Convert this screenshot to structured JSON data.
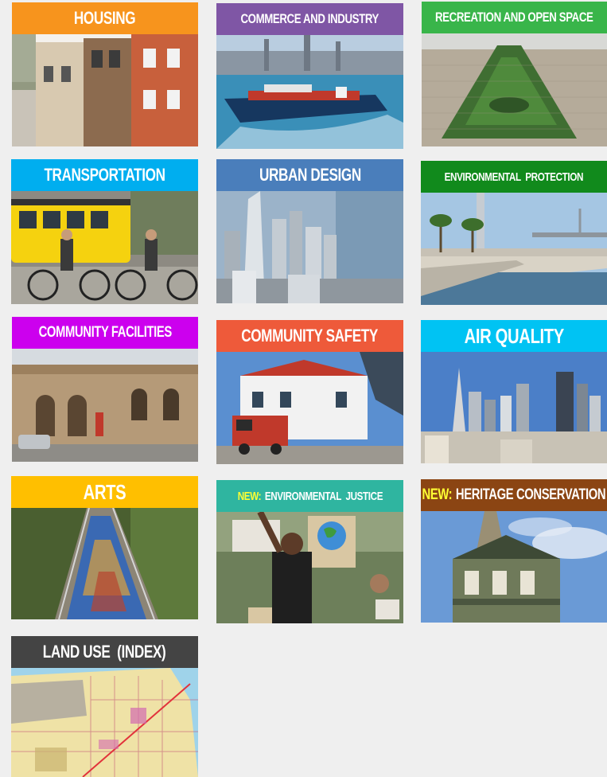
{
  "tiles": [
    {
      "id": "housing",
      "prefix": "",
      "label": "HOUSING",
      "color": "#f7941d"
    },
    {
      "id": "commerce",
      "prefix": "",
      "label": "COMMERCE AND INDUSTRY",
      "color": "#7f56a5"
    },
    {
      "id": "recreation",
      "prefix": "",
      "label": "RECREATION AND OPEN SPACE",
      "color": "#39b54a"
    },
    {
      "id": "transportation",
      "prefix": "",
      "label": "TRANSPORTATION",
      "color": "#00aeef"
    },
    {
      "id": "urban-design",
      "prefix": "",
      "label": "URBAN DESIGN",
      "color": "#4a7ebb"
    },
    {
      "id": "environmental-protection",
      "prefix": "",
      "label": "ENVIRONMENTAL  PROTECTION",
      "color": "#118a1c"
    },
    {
      "id": "community-facilities",
      "prefix": "",
      "label": "COMMUNITY FACILITIES",
      "color": "#cc00ee"
    },
    {
      "id": "community-safety",
      "prefix": "",
      "label": "COMMUNITY SAFETY",
      "color": "#ee5a3a"
    },
    {
      "id": "air-quality",
      "prefix": "",
      "label": "AIR QUALITY",
      "color": "#00c3f3"
    },
    {
      "id": "arts",
      "prefix": "",
      "label": "ARTS",
      "color": "#ffbf00"
    },
    {
      "id": "environmental-justice",
      "prefix": "NEW:",
      "label": "ENVIRONMENTAL  JUSTICE",
      "color": "#2fb5a0"
    },
    {
      "id": "heritage-conservation",
      "prefix": "NEW:",
      "label": "HERITAGE CONSERVATION",
      "color": "#8b4513"
    },
    {
      "id": "land-use",
      "prefix": "",
      "label": "LAND USE  (INDEX)",
      "color": "#444444"
    }
  ]
}
